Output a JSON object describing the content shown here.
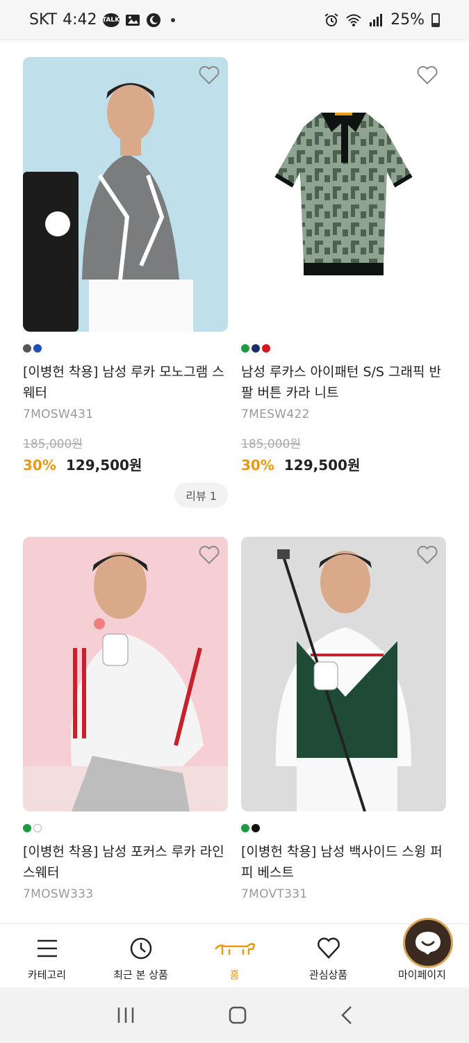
{
  "status_bar": {
    "carrier": "SKT",
    "time": "4:42",
    "talk_badge": "TALK",
    "battery": "25%"
  },
  "products": [
    {
      "title": "[이병헌 착용] 남성 루카 모노그램 스웨터",
      "code": "7MOSW431",
      "original_price": "185,000원",
      "discount": "30%",
      "price": "129,500원",
      "review": "리뷰 1",
      "colors": [
        "#555555",
        "#1f4fb5"
      ],
      "image_bg": "#bfe0ea",
      "image_icon": "model-in-grey-sweater"
    },
    {
      "title": "남성 루카스 아이패턴 S/S 그래픽 반팔 버튼 카라 니트",
      "code": "7MESW422",
      "original_price": "185,000원",
      "discount": "30%",
      "price": "129,500원",
      "colors": [
        "#1e9a43",
        "#1b2a6b",
        "#d8141c"
      ],
      "image_bg": "#ffffff",
      "image_icon": "polo-shirt"
    },
    {
      "title": "[이병헌 착용] 남성 포커스 루카 라인 스웨터",
      "code": "7MOSW333",
      "colors": [
        "#1e9a43",
        "#ffffff"
      ],
      "image_bg": "#f6cfd4",
      "image_icon": "model-in-white-sweater"
    },
    {
      "title": "[이병헌 착용] 남성 백사이드 스윙 퍼피 베스트",
      "code": "7MOVT331",
      "colors": [
        "#1e9a43",
        "#111111"
      ],
      "image_bg": "#dcdcdc",
      "image_icon": "model-in-green-vest"
    }
  ],
  "bottom_nav": [
    {
      "label": "카테고리",
      "icon": "menu-icon"
    },
    {
      "label": "최근 본 상품",
      "icon": "clock-icon"
    },
    {
      "label": "홈",
      "icon": "dog-logo-icon",
      "active": true
    },
    {
      "label": "관심상품",
      "icon": "heart-icon"
    },
    {
      "label": "마이페이지",
      "icon": "chat-icon"
    }
  ],
  "accent_color": "#e89a12"
}
